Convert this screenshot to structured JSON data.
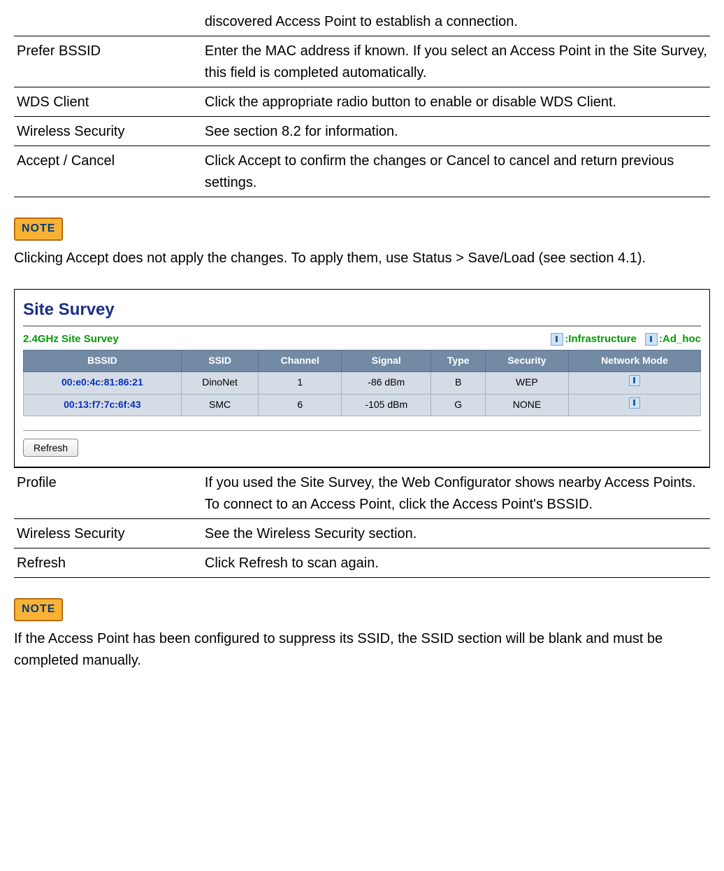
{
  "table1": {
    "rows": [
      {
        "key": "",
        "desc": "discovered Access Point to establish a connection."
      },
      {
        "key": "Prefer BSSID",
        "desc": "Enter the MAC address if known. If you select an Access Point in the Site Survey, this field is completed automatically."
      },
      {
        "key": "WDS Client",
        "desc": "Click the appropriate radio button to enable or disable WDS Client."
      },
      {
        "key": "Wireless Security",
        "desc": "See section 8.2 for information."
      },
      {
        "key": "Accept / Cancel",
        "desc": "Click Accept to confirm the changes or Cancel to cancel and return previous settings."
      }
    ]
  },
  "note1": {
    "badge": "NOTE",
    "text": "Clicking Accept does not apply the changes. To apply them, use Status > Save/Load (see section 4.1)."
  },
  "panel": {
    "title": "Site Survey",
    "subtitle": "2.4GHz Site Survey",
    "legend_infra": ":Infrastructure",
    "legend_adhoc": ":Ad_hoc",
    "headers": [
      "BSSID",
      "SSID",
      "Channel",
      "Signal",
      "Type",
      "Security",
      "Network Mode"
    ],
    "rows": [
      {
        "bssid": "00:e0:4c:81:86:21",
        "ssid": "DinoNet",
        "channel": "1",
        "signal": "-86 dBm",
        "type": "B",
        "security": "WEP",
        "mode": "infra"
      },
      {
        "bssid": "00:13:f7:7c:6f:43",
        "ssid": "SMC",
        "channel": "6",
        "signal": "-105 dBm",
        "type": "G",
        "security": "NONE",
        "mode": "infra"
      }
    ],
    "refresh_label": "Refresh"
  },
  "table2": {
    "rows": [
      {
        "key": "Profile",
        "desc": "If you used the Site Survey, the Web Configurator shows nearby Access Points. To connect to an Access Point, click the Access Point's BSSID."
      },
      {
        "key": "Wireless Security",
        "desc": "See the Wireless Security section."
      },
      {
        "key": "Refresh",
        "desc": "Click Refresh to scan again."
      }
    ]
  },
  "note2": {
    "badge": "NOTE",
    "text": "If the Access Point has been configured to suppress its SSID, the SSID section will be blank and must be completed manually."
  }
}
